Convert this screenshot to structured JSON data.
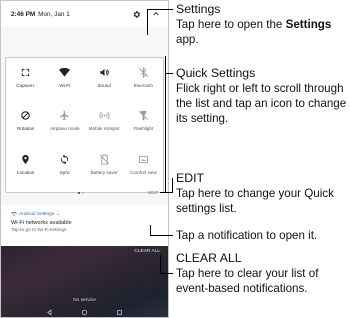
{
  "status_bar": {
    "time": "2:46 PM",
    "date": "Mon, Jan 1"
  },
  "quick_settings": {
    "tiles": [
      {
        "label": "Capture+",
        "icon": "capture-plus-icon",
        "active": true
      },
      {
        "label": "Wi-Fi",
        "icon": "wifi-icon",
        "active": true
      },
      {
        "label": "Sound",
        "icon": "sound-icon",
        "active": true
      },
      {
        "label": "Bluetooth",
        "icon": "bluetooth-icon",
        "active": false
      },
      {
        "label": "Rotation",
        "icon": "rotation-icon",
        "active": true
      },
      {
        "label": "Airplane mode",
        "icon": "airplane-icon",
        "active": false
      },
      {
        "label": "Mobile Hotspot",
        "icon": "hotspot-icon",
        "active": false
      },
      {
        "label": "Flashlight",
        "icon": "flashlight-icon",
        "active": false
      },
      {
        "label": "Location",
        "icon": "location-icon",
        "active": true
      },
      {
        "label": "Sync",
        "icon": "sync-icon",
        "active": true
      },
      {
        "label": "Battery saver",
        "icon": "battery-saver-icon",
        "active": false
      },
      {
        "label": "Comfort view",
        "icon": "comfort-view-icon",
        "active": false
      }
    ],
    "edit_label": "EDIT"
  },
  "notification": {
    "app": "Android Settings",
    "title": "Wi-Fi networks available",
    "text": "Tap to go to Wi-Fi settings"
  },
  "lockscreen": {
    "clear_all": "CLEAR ALL",
    "no_service": "No service"
  },
  "callouts": {
    "settings": {
      "title": "Settings",
      "desc_pre": "Tap here to open the ",
      "desc_bold": "Settings",
      "desc_post": " app."
    },
    "quick": {
      "title": "Quick Settings",
      "desc": "Flick right or left to scroll through the list and tap an icon to change its setting."
    },
    "edit": {
      "title": "EDIT",
      "desc": "Tap here to change your Quick settings list."
    },
    "notif": {
      "desc": "Tap a notification to open it."
    },
    "clear": {
      "title": "CLEAR ALL",
      "desc": "Tap here to clear your list of event-based notifications."
    }
  },
  "colors": {
    "notification_accent": "#2f6db5",
    "tile_active": "#222222",
    "tile_inactive": "#9a9a9a"
  }
}
